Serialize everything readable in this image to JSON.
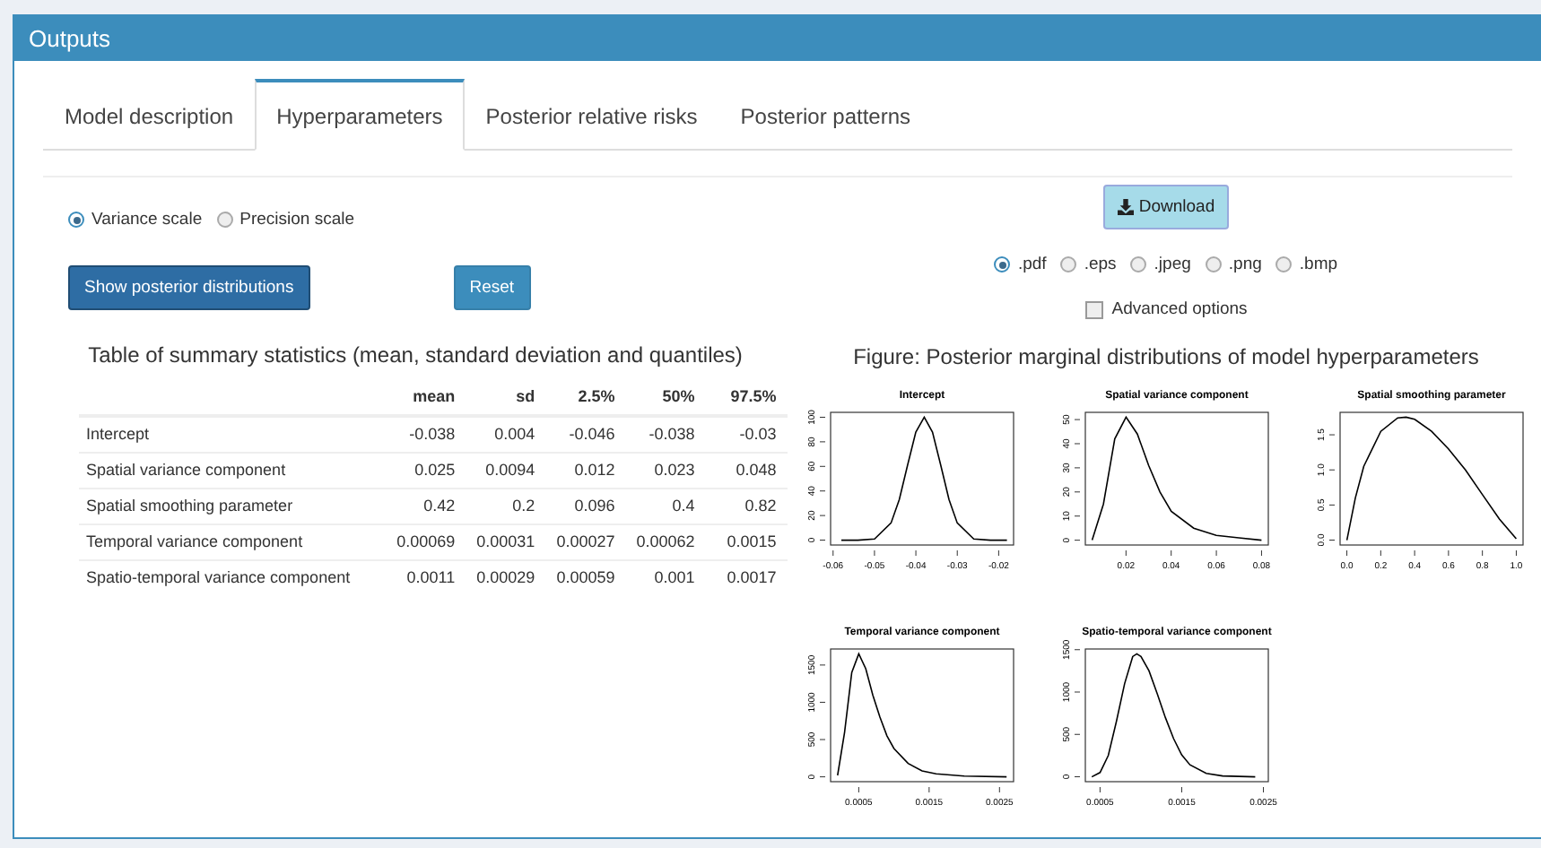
{
  "panel": {
    "title": "Outputs"
  },
  "tabs": [
    {
      "label": "Model description",
      "selected": false
    },
    {
      "label": "Hyperparameters",
      "selected": true
    },
    {
      "label": "Posterior relative risks",
      "selected": false
    },
    {
      "label": "Posterior patterns",
      "selected": false
    }
  ],
  "scale_options": [
    {
      "label": "Variance scale",
      "selected": true
    },
    {
      "label": "Precision scale",
      "selected": false
    }
  ],
  "buttons": [
    {
      "label": "Show posterior distributions",
      "kind": "primary"
    },
    {
      "label": "Reset",
      "kind": "secondary"
    }
  ],
  "table": {
    "title": "Table of summary statistics (mean, standard deviation and quantiles)",
    "columns": [
      "mean",
      "sd",
      "2.5%",
      "50%",
      "97.5%"
    ],
    "rows": [
      {
        "name": "Intercept",
        "values": [
          "-0.038",
          "0.004",
          "-0.046",
          "-0.038",
          "-0.03"
        ]
      },
      {
        "name": "Spatial variance component",
        "values": [
          "0.025",
          "0.0094",
          "0.012",
          "0.023",
          "0.048"
        ]
      },
      {
        "name": "Spatial smoothing parameter",
        "values": [
          "0.42",
          "0.2",
          "0.096",
          "0.4",
          "0.82"
        ]
      },
      {
        "name": "Temporal variance component",
        "values": [
          "0.00069",
          "0.00031",
          "0.00027",
          "0.00062",
          "0.0015"
        ]
      },
      {
        "name": "Spatio-temporal variance component",
        "values": [
          "0.0011",
          "0.00029",
          "0.00059",
          "0.001",
          "0.0017"
        ]
      }
    ]
  },
  "download": {
    "label": "Download",
    "formats": [
      {
        "label": ".pdf",
        "selected": true
      },
      {
        "label": ".eps",
        "selected": false
      },
      {
        "label": ".jpeg",
        "selected": false
      },
      {
        "label": ".png",
        "selected": false
      },
      {
        "label": ".bmp",
        "selected": false
      }
    ],
    "advanced_options": {
      "label": "Advanced options",
      "checked": false
    }
  },
  "figure": {
    "title": "Figure: Posterior marginal distributions of model hyperparameters",
    "plots": [
      {
        "chart_data": {
          "type": "line",
          "title": "Intercept",
          "x": [
            -0.058,
            -0.054,
            -0.05,
            -0.046,
            -0.044,
            -0.042,
            -0.04,
            -0.038,
            -0.036,
            -0.034,
            -0.032,
            -0.03,
            -0.026,
            -0.022,
            -0.018
          ],
          "series": [
            {
              "color": "#000000",
              "values": [
                0,
                0,
                1,
                14,
                33,
                61,
                88,
                100,
                88,
                61,
                33,
                14,
                1,
                0,
                0
              ]
            }
          ],
          "xlim": [
            -0.0606,
            -0.0164
          ],
          "ylim": [
            -4,
            104
          ],
          "xticks": [
            -0.06,
            -0.05,
            -0.04,
            -0.03,
            -0.02
          ],
          "yticks": [
            0,
            20,
            40,
            60,
            80,
            100
          ]
        }
      },
      {
        "chart_data": {
          "type": "line",
          "title": "Spatial variance component",
          "x": [
            0.005,
            0.01,
            0.015,
            0.02,
            0.025,
            0.03,
            0.035,
            0.04,
            0.05,
            0.06,
            0.07,
            0.08
          ],
          "series": [
            {
              "color": "#000000",
              "values": [
                0,
                15,
                42,
                51,
                44,
                31,
                20,
                12,
                5,
                2,
                1,
                0
              ]
            }
          ],
          "xlim": [
            0.002,
            0.083
          ],
          "ylim": [
            -2,
            53
          ],
          "xticks": [
            0.02,
            0.04,
            0.06,
            0.08
          ],
          "yticks": [
            0,
            10,
            20,
            30,
            40,
            50
          ]
        }
      },
      {
        "chart_data": {
          "type": "line",
          "title": "Spatial smoothing parameter",
          "x": [
            0,
            0.05,
            0.1,
            0.2,
            0.3,
            0.35,
            0.4,
            0.5,
            0.6,
            0.7,
            0.8,
            0.9,
            1.0
          ],
          "series": [
            {
              "color": "#000000",
              "values": [
                0,
                0.6,
                1.05,
                1.55,
                1.74,
                1.75,
                1.72,
                1.55,
                1.3,
                1.0,
                0.65,
                0.3,
                0.02
              ]
            }
          ],
          "xlim": [
            -0.04,
            1.04
          ],
          "ylim": [
            -0.07,
            1.82
          ],
          "xticks": [
            {
              "value": 0,
              "label": "0.0"
            },
            {
              "value": 0.2,
              "label": "0.2"
            },
            {
              "value": 0.4,
              "label": "0.4"
            },
            {
              "value": 0.6,
              "label": "0.6"
            },
            {
              "value": 0.8,
              "label": "0.8"
            },
            {
              "value": 1,
              "label": "1.0"
            }
          ],
          "yticks": [
            {
              "value": 0,
              "label": "0.0"
            },
            {
              "value": 0.5,
              "label": "0.5"
            },
            {
              "value": 1,
              "label": "1.0"
            },
            {
              "value": 1.5,
              "label": "1.5"
            }
          ]
        }
      },
      {
        "chart_data": {
          "type": "line",
          "title": "Temporal variance component",
          "x": [
            0.0002,
            0.0003,
            0.0004,
            0.0005,
            0.0006,
            0.0007,
            0.0008,
            0.0009,
            0.001,
            0.0012,
            0.0014,
            0.0016,
            0.002,
            0.0026
          ],
          "series": [
            {
              "color": "#000000",
              "values": [
                20,
                600,
                1400,
                1650,
                1450,
                1100,
                800,
                550,
                380,
                180,
                80,
                40,
                10,
                0
              ]
            }
          ],
          "xlim": [
            0.0001,
            0.0027
          ],
          "ylim": [
            -65,
            1715
          ],
          "xticks": [
            0.0005,
            0.0015,
            0.0025
          ],
          "yticks": [
            0,
            500,
            1000,
            1500
          ]
        }
      },
      {
        "chart_data": {
          "type": "line",
          "title": "Spatio-temporal variance component",
          "x": [
            0.0004,
            0.0005,
            0.0006,
            0.0007,
            0.0008,
            0.0009,
            0.00095,
            0.001,
            0.0011,
            0.0012,
            0.0013,
            0.0014,
            0.0015,
            0.0016,
            0.0018,
            0.002,
            0.0024
          ],
          "series": [
            {
              "color": "#000000",
              "values": [
                0,
                50,
                250,
                650,
                1100,
                1420,
                1450,
                1420,
                1250,
                980,
                700,
                450,
                260,
                140,
                40,
                10,
                0
              ]
            }
          ],
          "xlim": [
            0.00032,
            0.00256
          ],
          "ylim": [
            -58,
            1508
          ],
          "xticks": [
            0.0005,
            0.0015,
            0.0025
          ],
          "yticks": [
            0,
            500,
            1000,
            1500
          ]
        }
      }
    ]
  }
}
